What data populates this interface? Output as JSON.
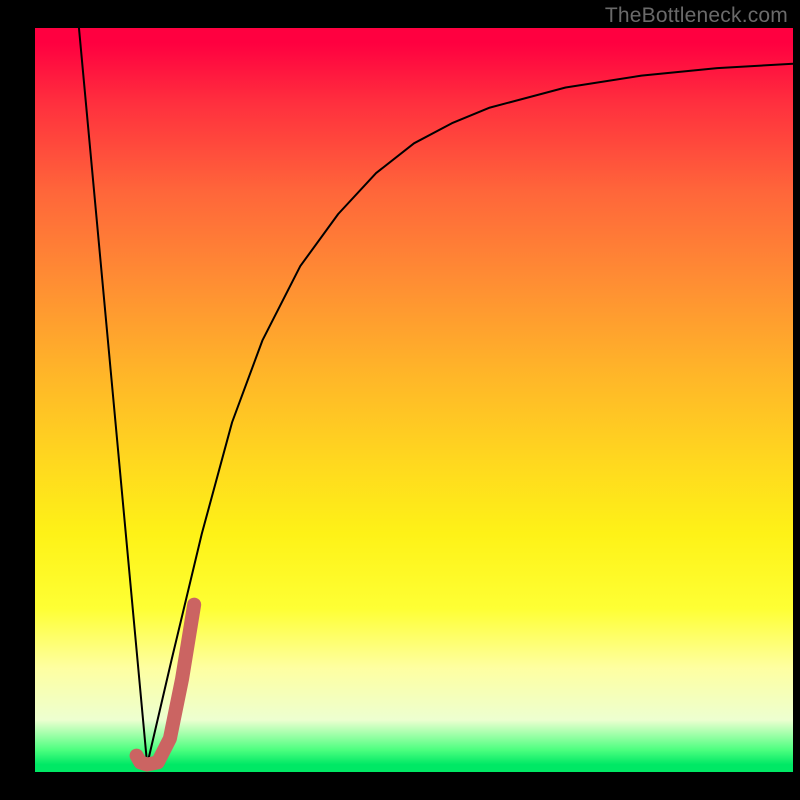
{
  "watermark": "TheBottleneck.com",
  "chart_data": {
    "type": "line",
    "title": "",
    "xlabel": "",
    "ylabel": "",
    "xlim": [
      0,
      100
    ],
    "ylim": [
      0,
      100
    ],
    "series": [
      {
        "name": "left-falling-line",
        "x": [
          5.8,
          14.8
        ],
        "values": [
          100,
          1
        ],
        "color": "#000000",
        "width": 2
      },
      {
        "name": "rising-curve",
        "x": [
          14.8,
          18,
          22,
          26,
          30,
          35,
          40,
          45,
          50,
          55,
          60,
          70,
          80,
          90,
          100
        ],
        "values": [
          1,
          15,
          32,
          47,
          58,
          68,
          75,
          80.5,
          84.5,
          87.2,
          89.3,
          92,
          93.6,
          94.6,
          95.2
        ],
        "color": "#000000",
        "width": 2
      },
      {
        "name": "red-hook",
        "x": [
          13.4,
          13.9,
          14.8,
          16.2,
          17.8,
          19.4,
          21.0
        ],
        "values": [
          2.2,
          1.3,
          1.0,
          1.3,
          4.5,
          12.5,
          22.5
        ],
        "color": "#cb6462",
        "width": 14
      }
    ]
  }
}
